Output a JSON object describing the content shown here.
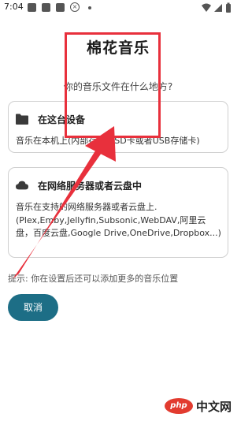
{
  "status_bar": {
    "time": "7:04",
    "icons": [
      "notification-square-icon",
      "notification-square-icon",
      "notification-square-icon",
      "blocked-circle-icon",
      "dot-icon"
    ],
    "right_icons": [
      "wifi-icon",
      "signal-icon",
      "battery-icon"
    ]
  },
  "dialog": {
    "title": "棉花音乐",
    "subtitle": "你的音乐文件在什么地方?",
    "options": [
      {
        "icon": "folder-icon",
        "title": "在这台设备",
        "description": "音乐在本机上(内部存储、SD卡或者USB存储卡)"
      },
      {
        "icon": "cloud-icon",
        "title": "在网络服务器或者云盘中",
        "description": "音乐在支持的网络服务器或者云盘上.(Plex,Emby,Jellyfin,Subsonic,WebDAV,阿里云盘，百度云盘,Google Drive,OneDrive,Dropbox...)"
      }
    ],
    "tip": "提示: 你在设置后还可以添加更多的音乐位置",
    "cancel_label": "取消"
  },
  "annotation": {
    "color": "#e8303c"
  },
  "watermark": {
    "badge": "php",
    "text": "中文网"
  },
  "colors": {
    "accent": "#1d6e86",
    "card_border": "#cfcfcf"
  }
}
